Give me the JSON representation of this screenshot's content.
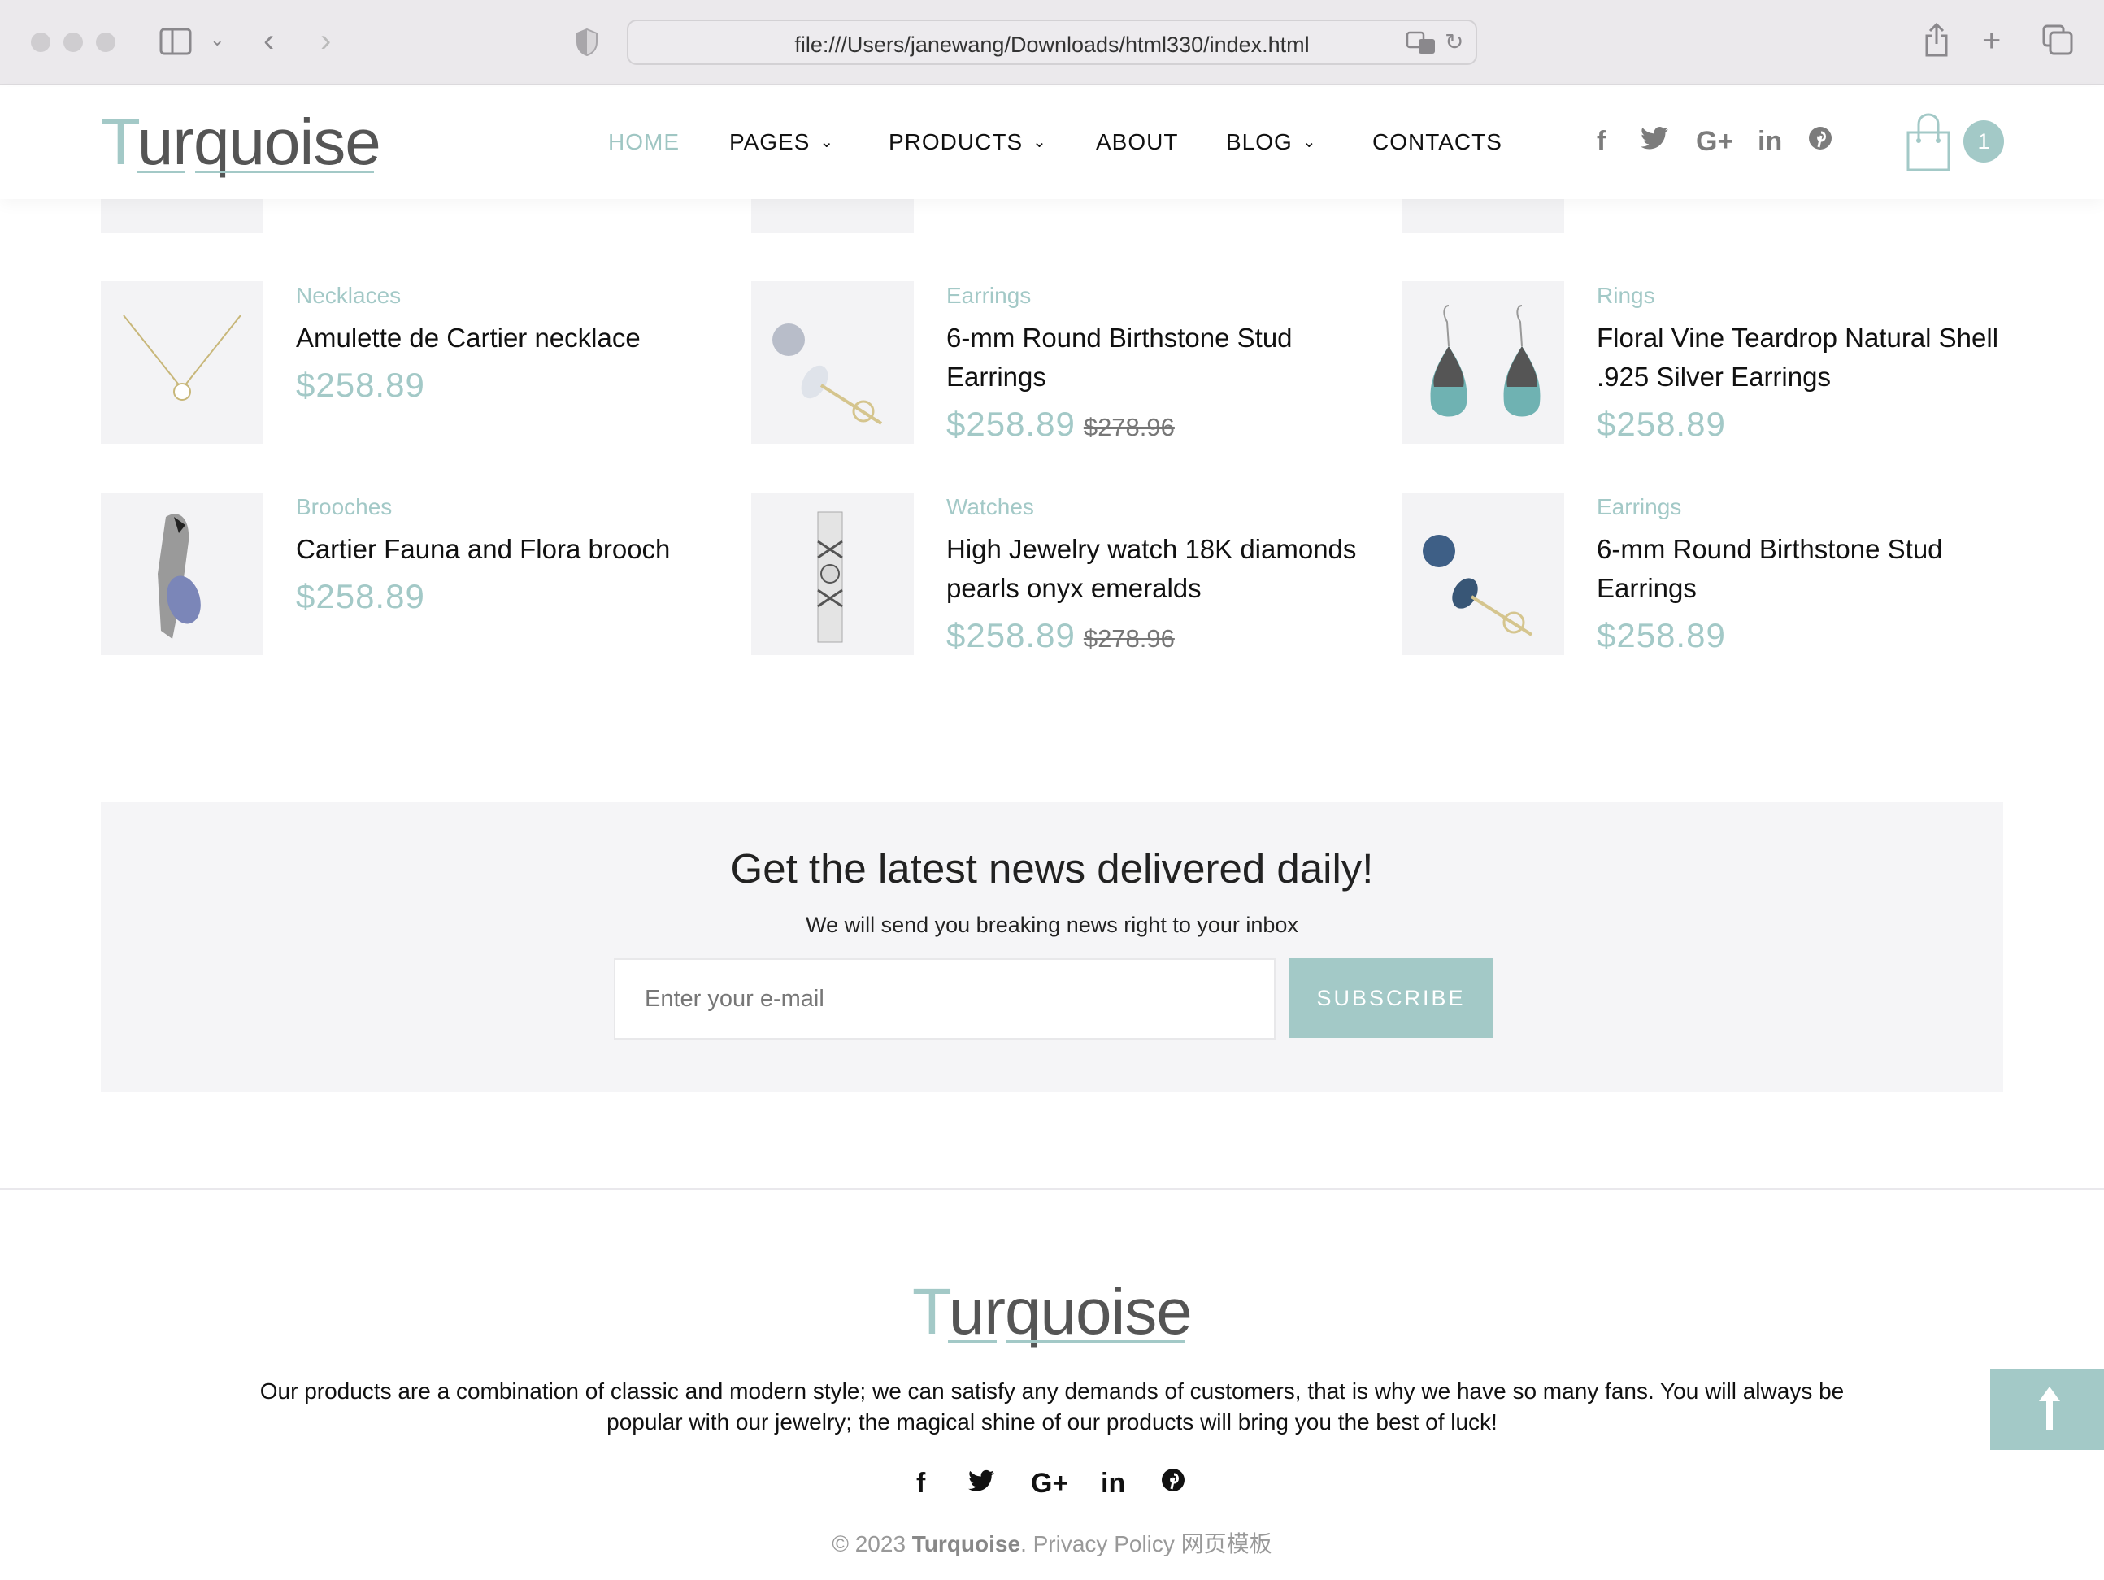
{
  "browser": {
    "url": "file:///Users/janewang/Downloads/html330/index.html"
  },
  "header": {
    "logo_first": "T",
    "logo_rest": "urquoise",
    "nav": [
      {
        "label": "HOME",
        "active": true,
        "dropdown": false
      },
      {
        "label": "PAGES",
        "active": false,
        "dropdown": true
      },
      {
        "label": "PRODUCTS",
        "active": false,
        "dropdown": true
      },
      {
        "label": "ABOUT",
        "active": false,
        "dropdown": false
      },
      {
        "label": "BLOG",
        "active": false,
        "dropdown": true
      },
      {
        "label": "CONTACTS",
        "active": false,
        "dropdown": false
      }
    ],
    "social": [
      "facebook-icon",
      "twitter-icon",
      "google-plus-icon",
      "linkedin-icon",
      "pinterest-icon"
    ],
    "cart_count": "1"
  },
  "products": [
    {
      "category": "Necklaces",
      "name": "Amulette de Cartier necklace",
      "price": "$258.89",
      "old_price": ""
    },
    {
      "category": "Earrings",
      "name": "6-mm Round Birthstone Stud Earrings",
      "price": "$258.89",
      "old_price": "$278.96"
    },
    {
      "category": "Rings",
      "name": "Floral Vine Teardrop Natural Shell .925 Silver Earrings",
      "price": "$258.89",
      "old_price": ""
    },
    {
      "category": "Brooches",
      "name": "Cartier Fauna and Flora brooch",
      "price": "$258.89",
      "old_price": ""
    },
    {
      "category": "Watches",
      "name": "High Jewelry watch 18K diamonds pearls onyx emeralds",
      "price": "$258.89",
      "old_price": "$278.96"
    },
    {
      "category": "Earrings",
      "name": "6-mm Round Birthstone Stud Earrings",
      "price": "$258.89",
      "old_price": ""
    }
  ],
  "newsletter": {
    "title": "Get the latest news delivered daily!",
    "subtitle": "We will send you breaking news right to your inbox",
    "email_placeholder": "Enter your e-mail",
    "subscribe_label": "SUBSCRIBE"
  },
  "footer": {
    "logo_first": "T",
    "logo_rest": "urquoise",
    "description": "Our products are a combination of classic and modern style; we can satisfy any demands of customers, that is why we have so many fans. You will always be popular with our jewelry; the magical shine of our products will bring you the best of luck!",
    "copyright_prefix": "© 2023 ",
    "brand": "Turquoise",
    "copyright_suffix": ". Privacy Policy 网页模板"
  },
  "colors": {
    "accent": "#a3c9c7",
    "text": "#111111",
    "muted": "#999999"
  }
}
